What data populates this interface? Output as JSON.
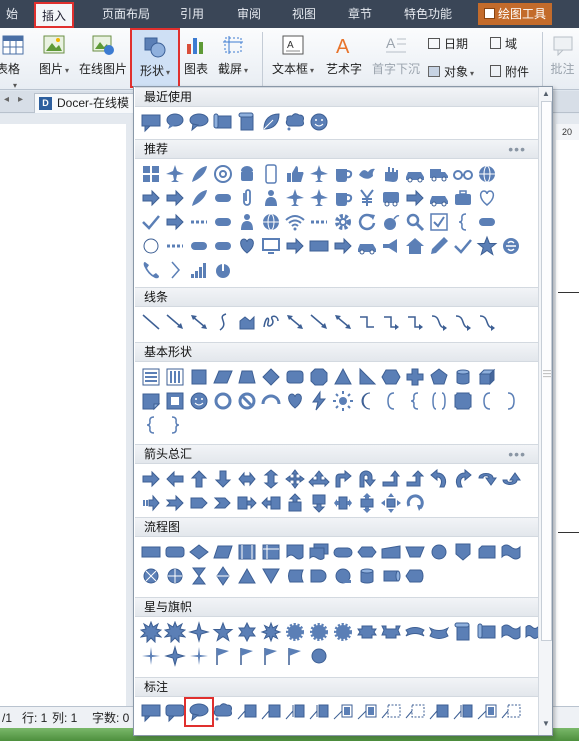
{
  "tabs": [
    "始",
    "插入",
    "页面布局",
    "引用",
    "审阅",
    "视图",
    "章节",
    "特色功能",
    "绘图工具"
  ],
  "ribbon": {
    "table_label": "表格",
    "picture_label": "图片",
    "online_picture_label": "在线图片",
    "shapes_label": "形状",
    "chart_label": "图表",
    "screenshot_label": "截屏",
    "textbox_label": "文本框",
    "wordart_label": "艺术字",
    "dropcap_label": "首字下沉",
    "date_label": "日期",
    "object_label": "对象",
    "field_label": "域",
    "attachment_label": "附件",
    "comment_label": "批注"
  },
  "doc_tab": {
    "title": "Docer-在线模"
  },
  "ruler": {
    "mark": "20"
  },
  "statusbar": {
    "page": "/1",
    "row": "行: 1",
    "col": "列: 1",
    "chars": "字数: 0"
  },
  "shapes_panel": {
    "sections": [
      {
        "title": "最近使用",
        "more": ""
      },
      {
        "title": "推荐",
        "more": "•••"
      },
      {
        "title": "线条",
        "more": ""
      },
      {
        "title": "基本形状",
        "more": ""
      },
      {
        "title": "箭头总汇",
        "more": "•••"
      },
      {
        "title": "流程图",
        "more": ""
      },
      {
        "title": "星与旗帜",
        "more": ""
      },
      {
        "title": "标注",
        "more": ""
      }
    ],
    "shape_color": "#5b7fb6",
    "highlight_color": "#e0302e",
    "selected_shape": "oval-callout"
  }
}
